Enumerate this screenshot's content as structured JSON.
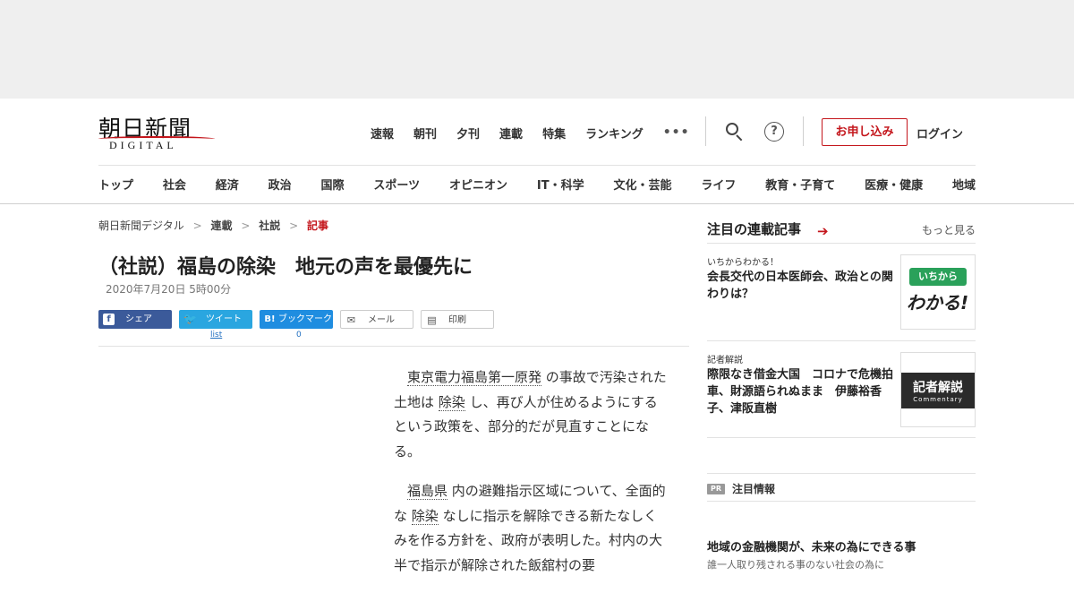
{
  "brand": {
    "name_kanji": "朝日新聞",
    "name_latin": "DIGITAL"
  },
  "topnav": {
    "items": [
      "速報",
      "朝刊",
      "夕刊",
      "連載",
      "特集",
      "ランキング"
    ],
    "more": "•••",
    "help_glyph": "?",
    "subscribe_label": "お申し込み",
    "login_label": "ログイン"
  },
  "categories": [
    "トップ",
    "社会",
    "経済",
    "政治",
    "国際",
    "スポーツ",
    "オピニオン",
    "IT・科学",
    "文化・芸能",
    "ライフ",
    "教育・子育て",
    "医療・健康",
    "地域"
  ],
  "breadcrumb": {
    "home": "朝日新聞デジタル",
    "series": "連載",
    "section": "社説",
    "current": "記事",
    "sep": ">"
  },
  "article": {
    "title": "（社説）福島の除染　地元の声を最優先に",
    "date": "2020年7月20日 5時00分",
    "p1": {
      "link1": "東京電力福島第一原発",
      "t1": "の事故で汚染された土地は",
      "link2": "除染",
      "t2": "し、再び人が住めるようにするという政策を、部分的だが見直すことになる。"
    },
    "p2": {
      "link1": "福島県",
      "t1": "内の避難指示区域について、全面的な",
      "link2": "除染",
      "t2": "なしに指示を解除できる新たなしくみを作る方針を、政府が表明した。村内の大半で指示が解除された飯舘村の要"
    }
  },
  "share": {
    "facebook": {
      "glyph": "f",
      "label": "シェア"
    },
    "twitter": {
      "glyph": "🐦",
      "label": "ツイート",
      "count": "list"
    },
    "hatena": {
      "glyph": "B!",
      "label": "ブックマーク",
      "count": "0"
    },
    "mail": {
      "glyph": "✉",
      "label": "メール"
    },
    "print": {
      "glyph": "▤",
      "label": "印刷"
    }
  },
  "sidebar": {
    "title": "注目の連載記事",
    "arrow": "➔",
    "more_label": "もっと見る",
    "cards": [
      {
        "kicker": "いちからわかる！",
        "title": "会長交代の日本医師会、政治との関わりは？",
        "thumb_pill": "いちから",
        "thumb_big": "わかる!"
      },
      {
        "kicker": "記者解説",
        "title": "際限なき借金大国　コロナで危機拍車、財源語られぬまま　伊藤裕香子、津阪直樹",
        "thumb_k1": "記者解説",
        "thumb_k2": "Commentary"
      }
    ],
    "pr_badge": "PR",
    "pr_label": "注目情報",
    "pr_item_title": "地域の金融機関が、未来の為にできる事",
    "pr_item_sub": "誰一人取り残される事のない社会の為に"
  },
  "colors": {
    "accent": "#c4161c",
    "facebook": "#3b5a9a",
    "twitter": "#2aa6e0",
    "hatena": "#1f8de0"
  }
}
